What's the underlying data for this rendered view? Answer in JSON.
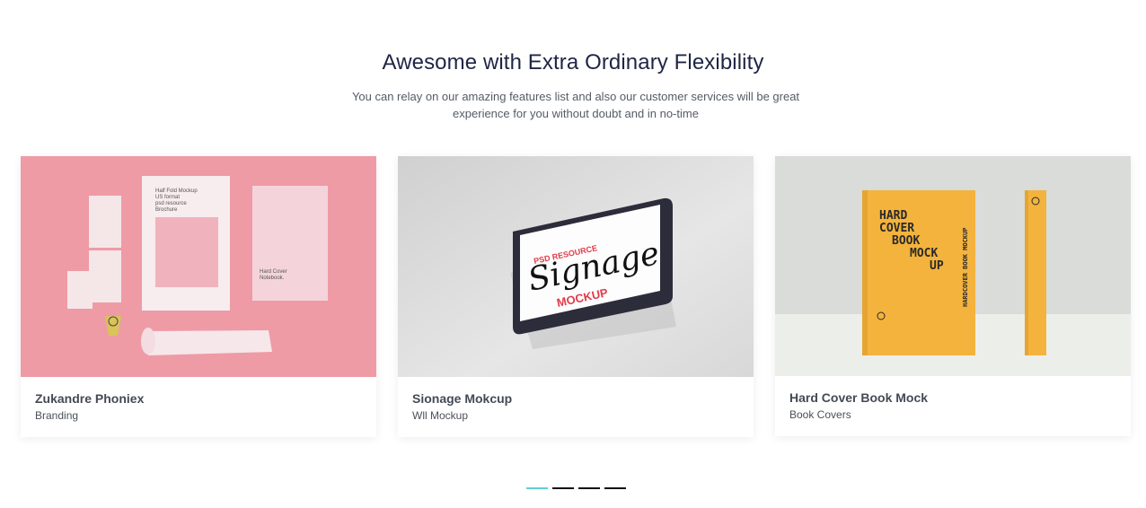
{
  "section": {
    "heading": "Awesome with Extra Ordinary Flexibility",
    "subtitle": "You can relay on our amazing features list and also our customer services will be great experience for you without doubt and in no-time"
  },
  "cards": [
    {
      "title": "Zukandre Phoniex",
      "category": "Branding",
      "image": {
        "subject": "stationery-mockup",
        "background": "#ee9ba6",
        "card_text": [
          "Half Fold Mockup",
          "US format",
          "psd resource",
          "Brochure",
          "Template."
        ],
        "notebook_text": [
          "Hard Cover",
          "Notebook."
        ]
      }
    },
    {
      "title": "Sionage Mokcup",
      "category": "Wll Mockup",
      "image": {
        "subject": "signage-mockup",
        "background": "#dcdcdc",
        "top_text": "PSD RESOURCE",
        "script_text": "Signage",
        "bottom_text": "MOCKUP"
      }
    },
    {
      "title": "Hard Cover Book Mock",
      "category": "Book Covers",
      "image": {
        "subject": "book-mockup",
        "background": "#d9dcd8",
        "book_color": "#f3b33d",
        "cover_lines": [
          "HARD",
          "COVER",
          "BOOK",
          "MOCK",
          "UP"
        ],
        "spine_text": "HARDCOVER BOOK MOCKUP"
      }
    }
  ],
  "pagination": {
    "count": 4,
    "active_index": 0,
    "active_color": "#5ed1d4",
    "inactive_color": "#111111"
  }
}
